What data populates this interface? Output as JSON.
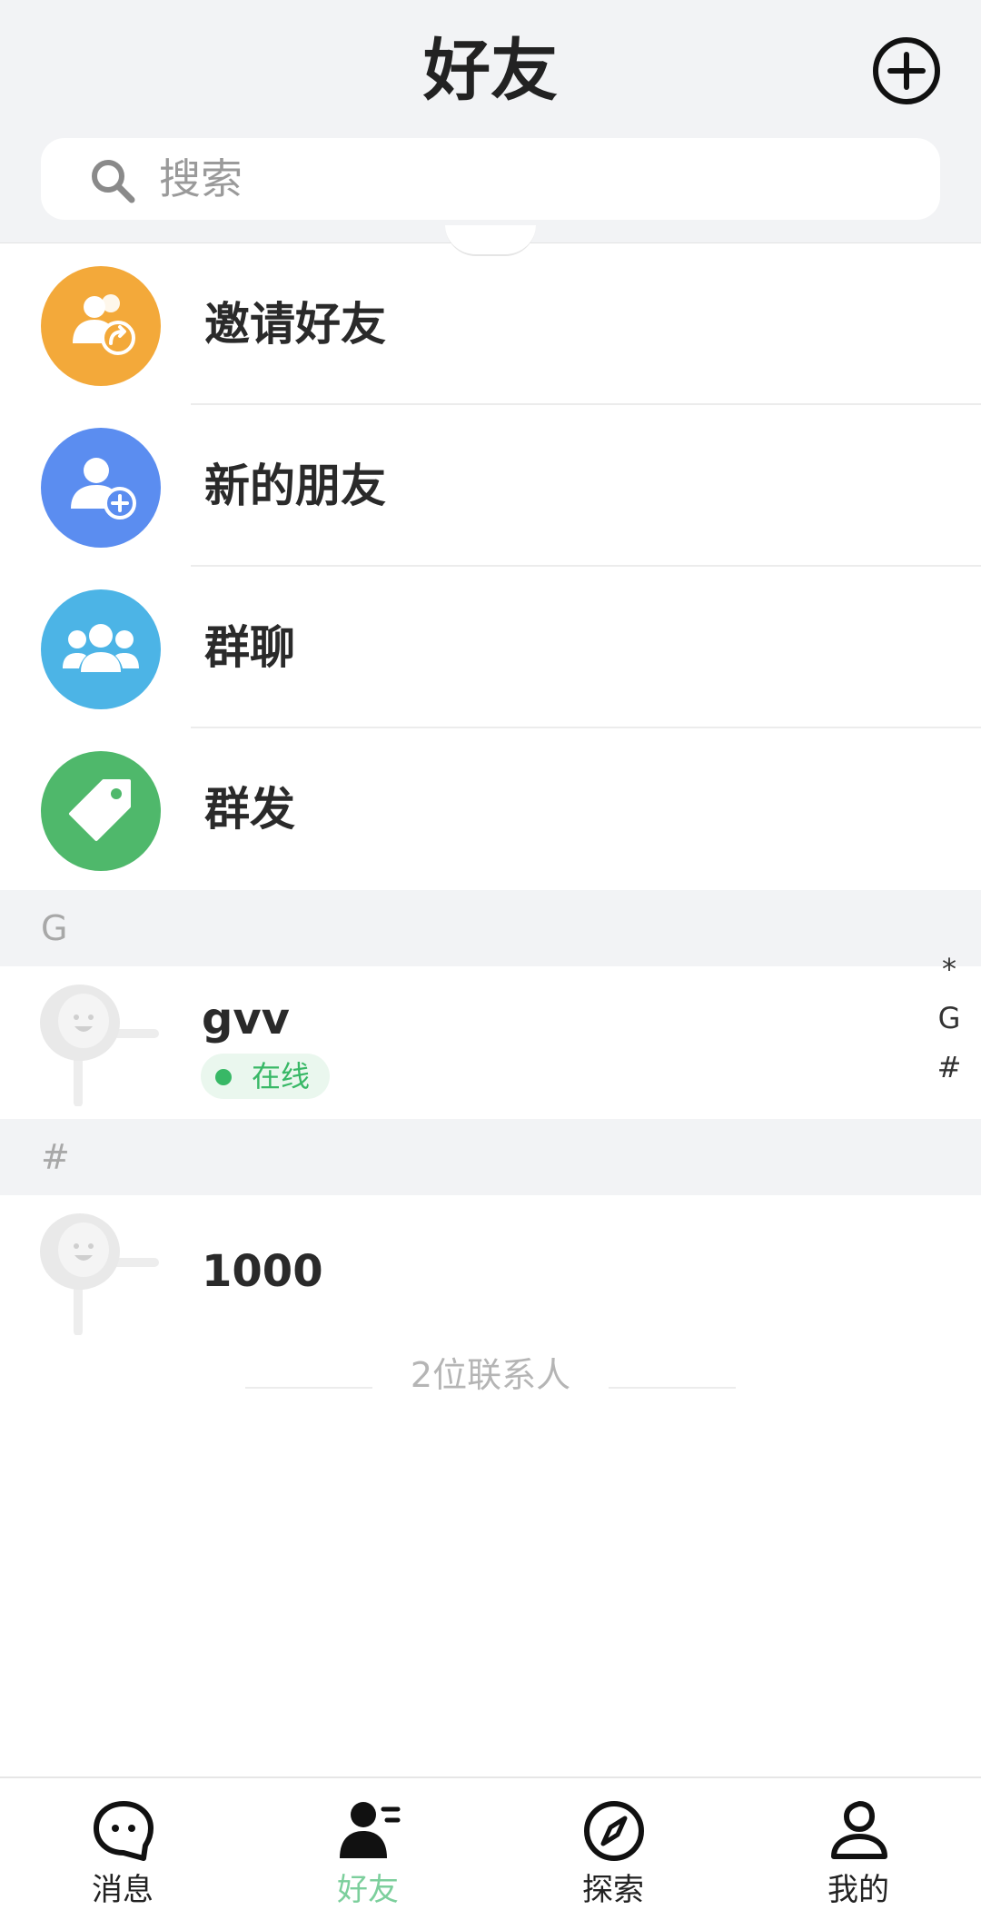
{
  "header": {
    "title": "好友",
    "add_icon": "plus-circle-icon"
  },
  "search": {
    "placeholder": "搜索",
    "icon": "search-icon"
  },
  "menu": [
    {
      "label": "邀请好友",
      "icon": "invite-friends-icon",
      "color": "#f3a93a"
    },
    {
      "label": "新的朋友",
      "icon": "new-friend-icon",
      "color": "#5b8df0"
    },
    {
      "label": "群聊",
      "icon": "group-chat-icon",
      "color": "#4cb4e6"
    },
    {
      "label": "群发",
      "icon": "tag-icon",
      "color": "#4fb86b"
    }
  ],
  "sections": [
    {
      "letter": "G",
      "contacts": [
        {
          "name": "gvv",
          "status": "在线"
        }
      ]
    },
    {
      "letter": "#",
      "contacts": [
        {
          "name": "1000"
        }
      ]
    }
  ],
  "index_bar": [
    "*",
    "G",
    "#"
  ],
  "contact_count": "2位联系人",
  "bottom_nav": [
    {
      "label": "消息",
      "icon": "message-icon",
      "active": false
    },
    {
      "label": "好友",
      "icon": "friends-icon",
      "active": true
    },
    {
      "label": "探索",
      "icon": "compass-icon",
      "active": false
    },
    {
      "label": "我的",
      "icon": "profile-icon",
      "active": false
    }
  ],
  "colors": {
    "accent": "#7ccf9c",
    "online": "#38b866",
    "header_bg": "#f2f3f5"
  }
}
